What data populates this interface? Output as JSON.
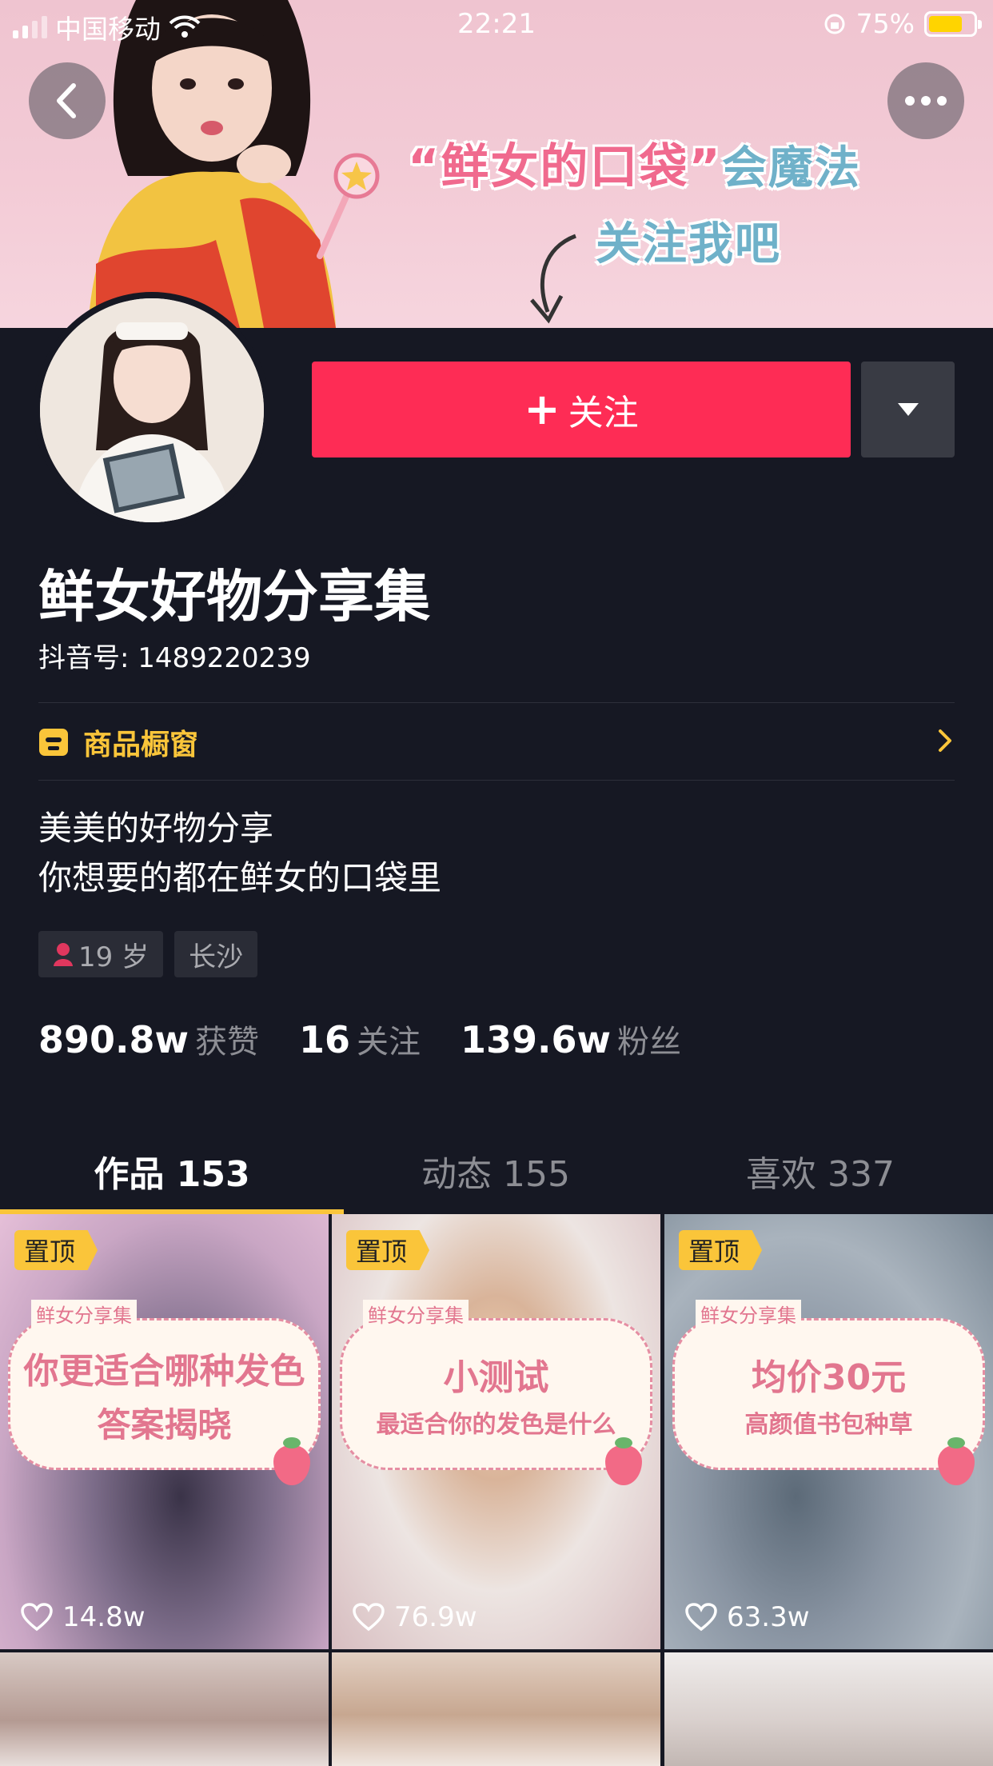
{
  "status_bar": {
    "carrier": "中国移动",
    "time": "22:21",
    "battery": "75%",
    "battery_level": 0.75
  },
  "banner": {
    "title_main": "“鲜女的口袋”",
    "title_tail": "会魔法",
    "subtitle": "关注我吧"
  },
  "profile": {
    "follow_label": "关注",
    "name": "鲜女好物分享集",
    "douyin_id": "抖音号: 1489220239",
    "shop_label": "商品橱窗",
    "bio_line1": "美美的好物分享",
    "bio_line2": "你想要的都在鲜女的口袋里",
    "tag_age": "19 岁",
    "tag_city": "长沙"
  },
  "stats": [
    {
      "num": "890.8w",
      "label": "获赞"
    },
    {
      "num": "16",
      "label": "关注"
    },
    {
      "num": "139.6w",
      "label": "粉丝"
    }
  ],
  "tabs": [
    {
      "label": "作品 153",
      "active": true
    },
    {
      "label": "动态 155",
      "active": false
    },
    {
      "label": "喜欢 337",
      "active": false
    }
  ],
  "videos": [
    {
      "pin": "置顶",
      "brand": "鲜女分享集",
      "line1": "你更适合哪种发色",
      "line2": "答案揭晓",
      "likes": "14.8w"
    },
    {
      "pin": "置顶",
      "brand": "鲜女分享集",
      "line1": "小测试",
      "line2": "最适合你的发色是什么",
      "likes": "76.9w"
    },
    {
      "pin": "置顶",
      "brand": "鲜女分享集",
      "line1": "均价30元",
      "line2": "高颜值书包种草",
      "likes": "63.3w"
    }
  ],
  "colors": {
    "bg": "#161823",
    "follow": "#fe2c55",
    "accent": "#fac53a"
  }
}
